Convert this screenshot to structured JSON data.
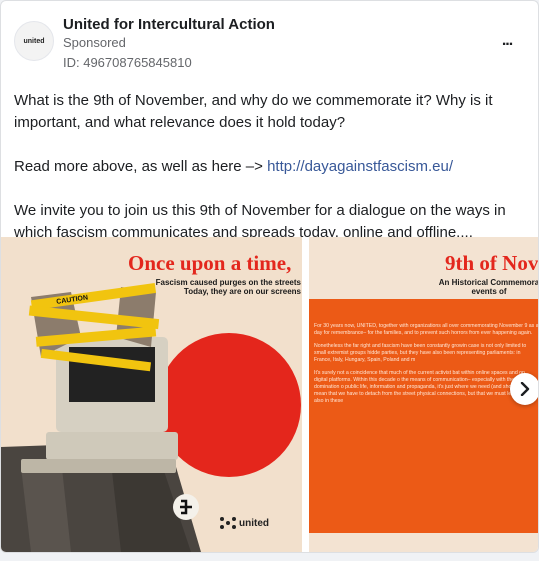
{
  "post": {
    "page_name": "United for Intercultural Action",
    "sponsored_label": "Sponsored",
    "ad_id": "ID: 496708765845810",
    "avatar_text": "united",
    "more_icon": "...",
    "body": {
      "p1": "What is the 9th of November, and why do we commemorate it? Why is it important, and what relevance does it hold today?",
      "p2_prefix": "Read more above, as well as here –> ",
      "p2_link": "http://dayagainstfascism.eu/",
      "p3": "We invite you to join us this 9th of November for a dialogue on the ways in which fascism communicates and spreads today, online and offline...."
    }
  },
  "carousel": {
    "slide1": {
      "title": "Once upon a time,",
      "subtitle_1": "Fascism caused purges on the streets",
      "subtitle_2": "Today, they are on our screens",
      "tape_text": "CAUTION",
      "logo_text": "united"
    },
    "slide2": {
      "title": "9th of Nov",
      "subtitle_1": "An Historical Commemora",
      "subtitle_2": "events of",
      "para1": "For 30 years now, UNITED, together with organizations all over commemorating November 9 as a day for remembrance– for the families, and to prevent such horrors from ever happening again.",
      "para2": "Nonetheless the far right and fascism have been constantly growin case is not only limited to small extremist groups hidde parties, but they have also been representing parliaments: in France, Italy, Hungary, Spain, Poland and m",
      "para3": "It's surely not a coincidence that much of the current activist bat within online spaces and on digital platforms. Within this decade o the means of communication– especially with the domination o public life, information and propaganda, it's just where we need (and shouldn't) mean that we have to detach from the street physical connections, but that we must learn to move also in these"
    },
    "next_icon": "chevron-right"
  },
  "colors": {
    "link": "#385898",
    "accent_red": "#e3271d",
    "panel_orange": "#ec5a16"
  }
}
